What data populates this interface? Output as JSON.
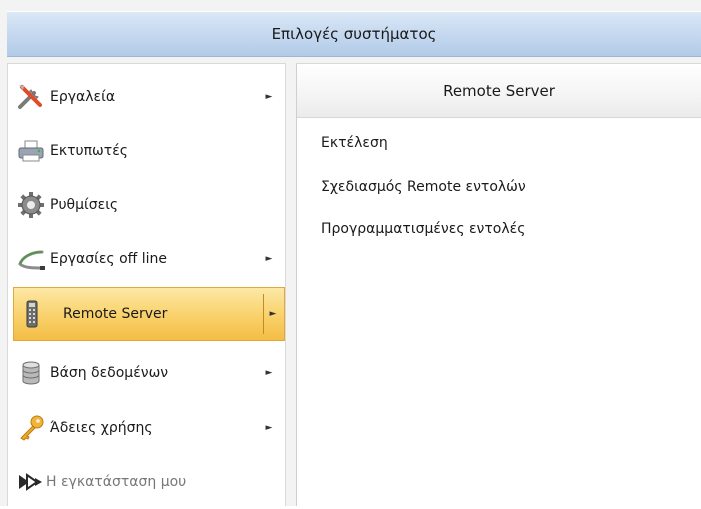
{
  "window": {
    "title": "Επιλογές συστήματος"
  },
  "menu": {
    "items": [
      {
        "label": "Εργαλεία",
        "icon": "tools-icon",
        "has_submenu": true
      },
      {
        "label": "Εκτυπωτές",
        "icon": "printer-icon",
        "has_submenu": false
      },
      {
        "label": "Ρυθμίσεις",
        "icon": "gear-icon",
        "has_submenu": false
      },
      {
        "label": "Εργασίες off line",
        "icon": "cable-icon",
        "has_submenu": true
      },
      {
        "label": "Remote Server",
        "icon": "remote-control-icon",
        "has_submenu": true,
        "active": true
      },
      {
        "label": "Βάση δεδομένων",
        "icon": "database-icon",
        "has_submenu": true
      },
      {
        "label": "Άδειες χρήσης",
        "icon": "key-icon",
        "has_submenu": true
      },
      {
        "label": "Η εγκατάσταση μου",
        "icon": "installation-icon",
        "has_submenu": false,
        "disabled": true
      }
    ],
    "arrow_glyph": "►"
  },
  "submenu": {
    "title": "Remote Server",
    "items": [
      {
        "label": "Εκτέλεση"
      },
      {
        "label": "Σχεδιασμός Remote εντολών"
      },
      {
        "label": "Προγραμματισμένες εντολές"
      }
    ]
  },
  "colors": {
    "active_item": "#f9d36e",
    "title_bar": "#c3d7ef"
  }
}
